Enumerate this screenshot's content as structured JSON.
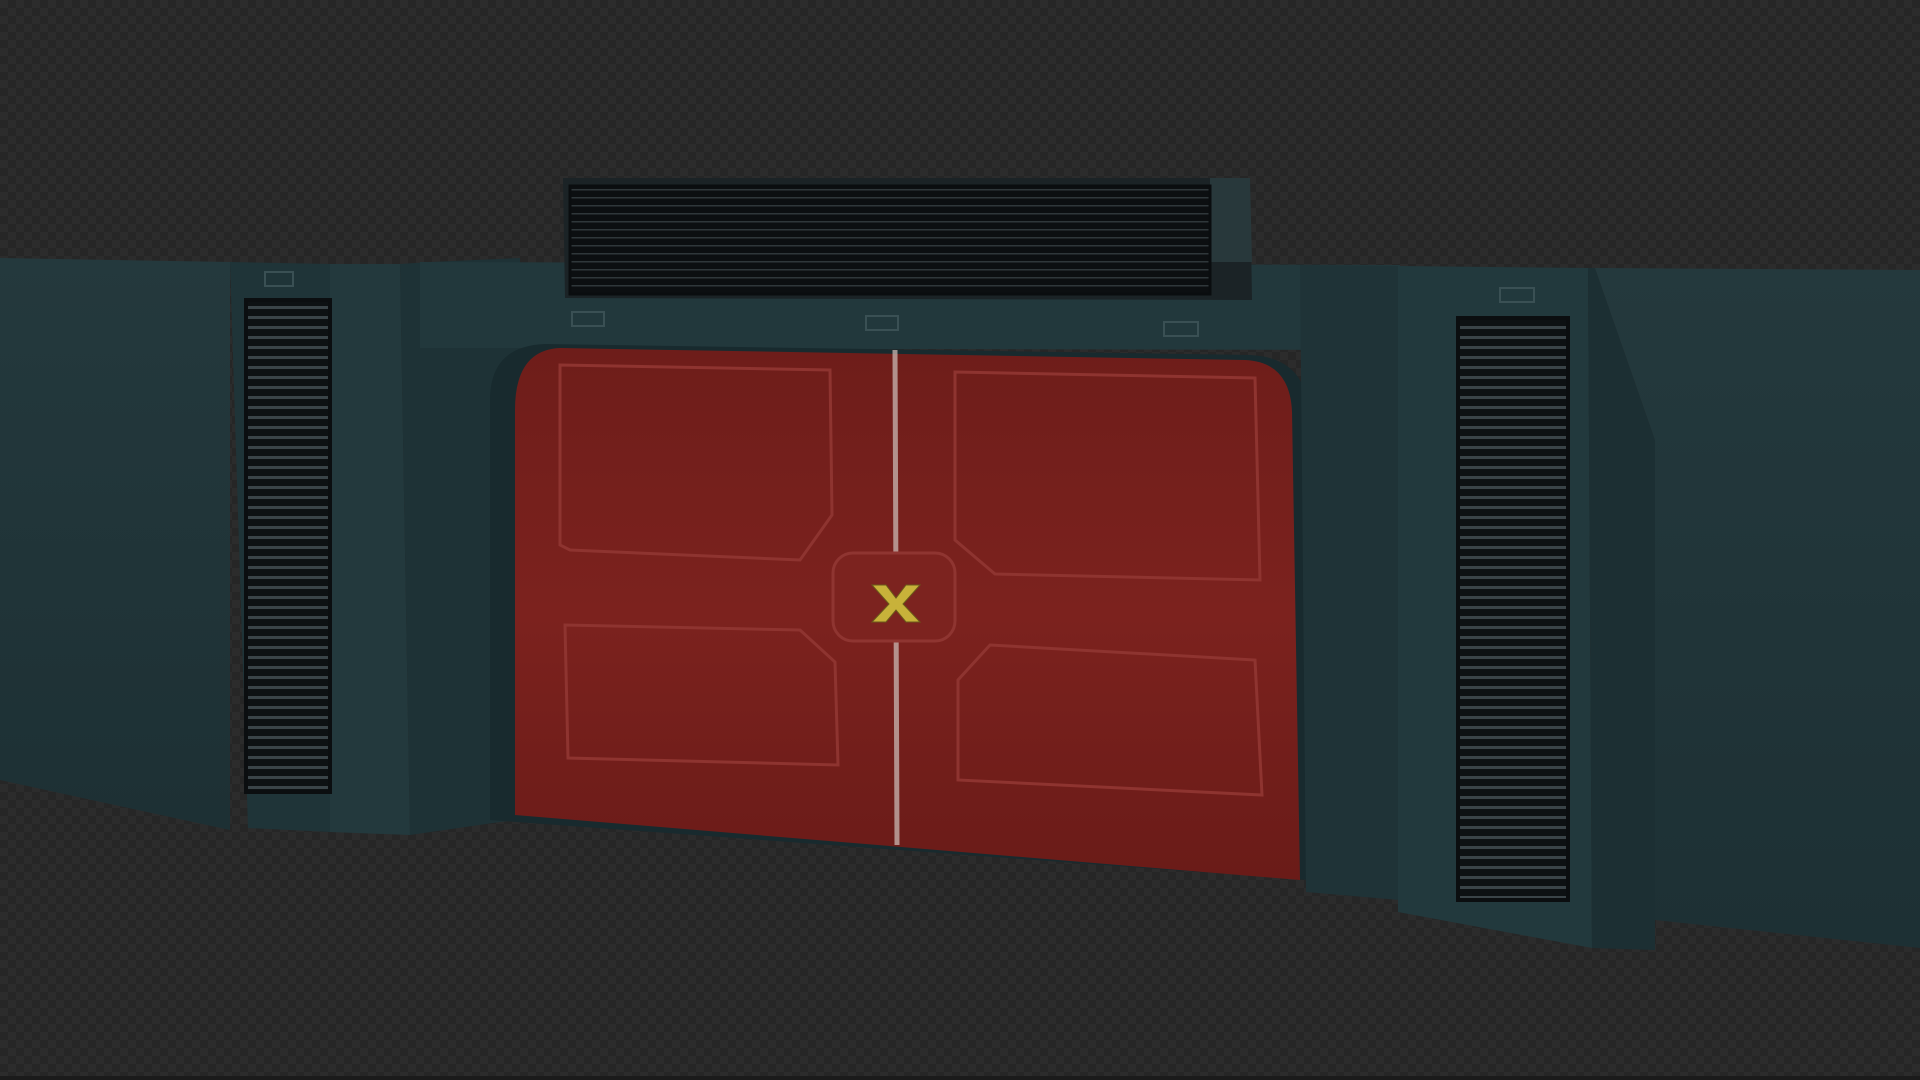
{
  "scene": {
    "description_hidden": "",
    "palette": {
      "wall": "#22393d",
      "wall_dark": "#1a2c30",
      "wall_light": "#2a4448",
      "door_red": "#7a1f1c",
      "door_red_dark": "#5e1816",
      "vent_dark": "#111518",
      "emblem_yellow": "#c8b23a",
      "checker_light": "#2c2c2c",
      "checker_dark": "#262626"
    },
    "icons": [
      "door-emblem-icon"
    ]
  }
}
